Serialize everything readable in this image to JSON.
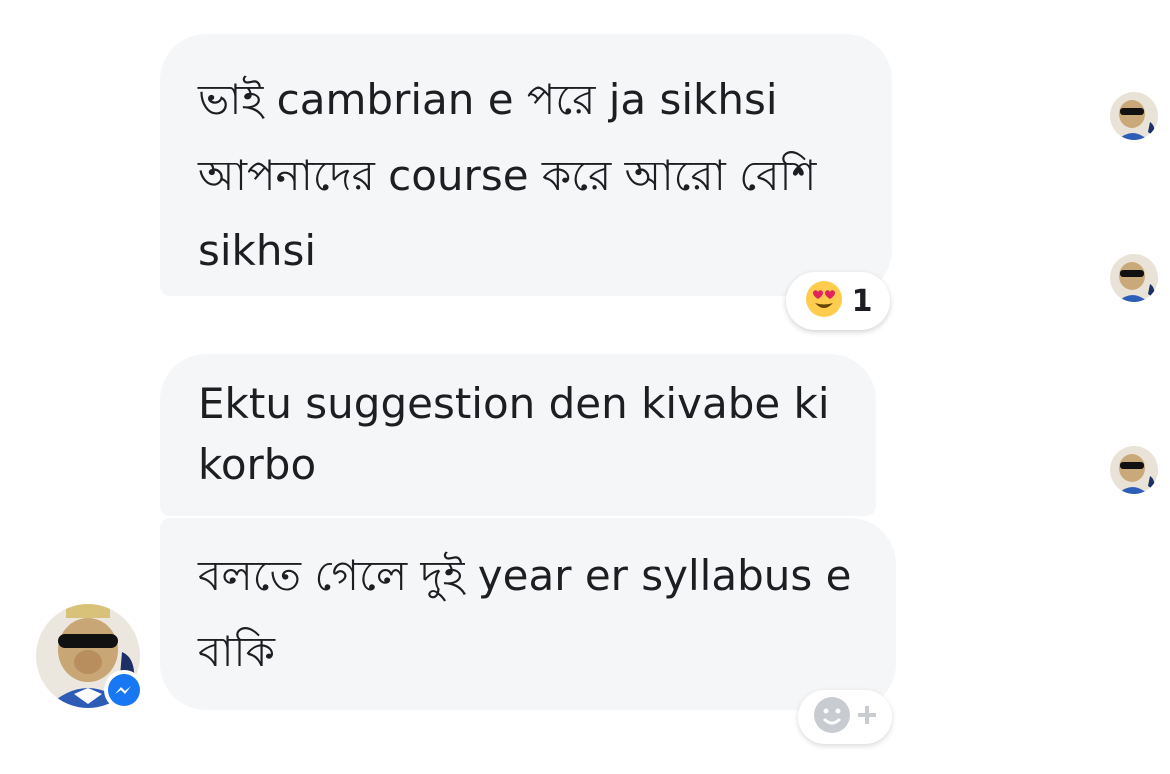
{
  "messages": [
    {
      "lines": [
        "ভাই cambrian e পরে ja sikhsi",
        "আপনাদের course করে আরো বেশি",
        "sikhsi"
      ]
    },
    {
      "lines": [
        "Ektu suggestion den kivabe ki",
        "korbo"
      ]
    },
    {
      "lines": [
        "বলতে গেলে দুই year er syllabus e",
        "বাকি"
      ]
    }
  ],
  "reaction": {
    "emoji": "heart-eyes-emoji",
    "count": "1"
  },
  "icons": {
    "add_reaction": "smiley-plus-icon",
    "messenger_badge": "messenger-icon",
    "seen_indicator": "seen-avatar-icon"
  },
  "colors": {
    "bubble_bg": "#f5f6f8",
    "text": "#1c1e21",
    "messenger_blue": "#1877f2",
    "add_reaction_icon": "#c8cbd0"
  }
}
